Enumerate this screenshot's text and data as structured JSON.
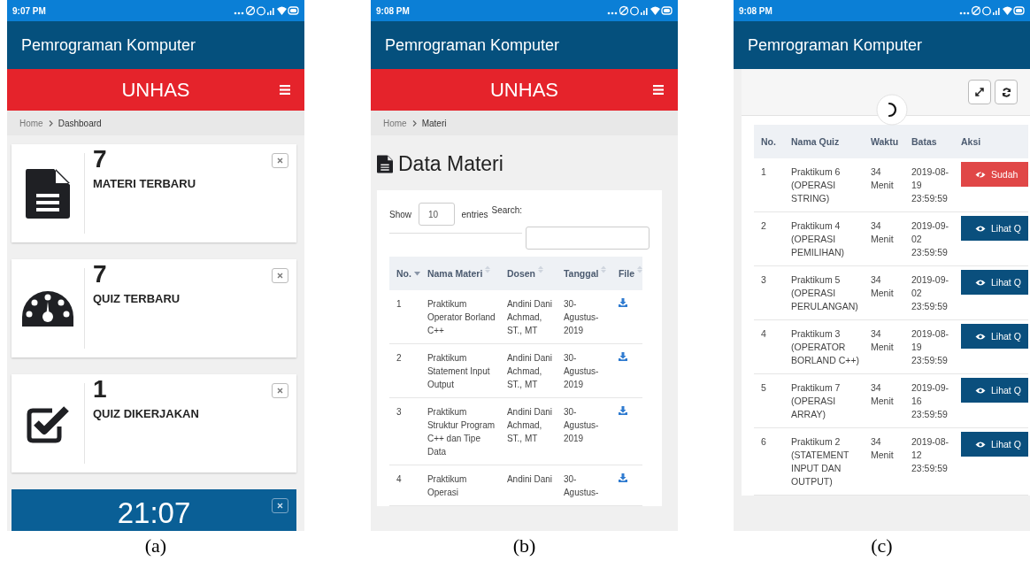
{
  "panels": [
    {
      "kind": "dashboard",
      "caption": "(a)",
      "status_time": "9:07 PM",
      "app_title": "Pemrograman Komputer",
      "brand": "UNHAS",
      "breadcrumb": [
        "Home",
        "Dashboard"
      ],
      "cards": [
        {
          "kind": "document",
          "count": "7",
          "label": "MATERI TERBARU"
        },
        {
          "kind": "gauge",
          "count": "7",
          "label": "QUIZ TERBARU"
        },
        {
          "kind": "checkbox",
          "count": "1",
          "label": "QUIZ DIKERJAKAN"
        }
      ],
      "clock": "21:07"
    },
    {
      "kind": "materials",
      "caption": "(b)",
      "status_time": "9:08 PM",
      "app_title": "Pemrograman Komputer",
      "brand": "UNHAS",
      "breadcrumb": [
        "Home",
        "Materi"
      ],
      "page_title": "Data Materi",
      "show_label": "Show",
      "show_value": "10",
      "entries_label": "entries",
      "search_label": "Search:",
      "columns": [
        {
          "label": "No.",
          "sorted": true
        },
        {
          "label": "Nama Materi",
          "sorted": false
        },
        {
          "label": "Dosen",
          "sorted": false
        },
        {
          "label": "Tanggal",
          "sorted": false
        },
        {
          "label": "File",
          "sorted": false
        }
      ],
      "rows": [
        {
          "no": "1",
          "name": "Praktikum Operator Borland C++",
          "lecturer": "Andini Dani Achmad, ST., MT",
          "date": "30-Agustus-2019"
        },
        {
          "no": "2",
          "name": "Praktikum Statement Input Output",
          "lecturer": "Andini Dani Achmad, ST., MT",
          "date": "30-Agustus-2019"
        },
        {
          "no": "3",
          "name": "Praktikum Struktur Program C++ dan Tipe Data",
          "lecturer": "Andini Dani Achmad, ST., MT",
          "date": "30-Agustus-2019"
        },
        {
          "no": "4",
          "name": "Praktikum Operasi",
          "lecturer": "Andini Dani",
          "date": "30-Agustus-"
        }
      ]
    },
    {
      "kind": "quizzes",
      "caption": "(c)",
      "status_time": "9:08 PM",
      "app_title": "Pemrograman Komputer",
      "columns": [
        "No.",
        "Nama Quiz",
        "Waktu",
        "Batas",
        "Aksi"
      ],
      "rows": [
        {
          "no": "1",
          "name": "Praktikum 6 (OPERASI STRING)",
          "duration": "34 Menit",
          "deadline": "2019-08-19 23:59:59",
          "action": {
            "kind": "done",
            "label": "Sudah"
          }
        },
        {
          "no": "2",
          "name": "Praktikum 4 (OPERASI PEMILIHAN)",
          "duration": "34 Menit",
          "deadline": "2019-09-02 23:59:59",
          "action": {
            "kind": "view",
            "label": "Lihat Q"
          }
        },
        {
          "no": "3",
          "name": "Praktikum 5 (OPERASI PERULANGAN)",
          "duration": "34 Menit",
          "deadline": "2019-09-02 23:59:59",
          "action": {
            "kind": "view",
            "label": "Lihat Q"
          }
        },
        {
          "no": "4",
          "name": "Praktikum 3 (OPERATOR BORLAND C++)",
          "duration": "34 Menit",
          "deadline": "2019-08-19 23:59:59",
          "action": {
            "kind": "view",
            "label": "Lihat Q"
          }
        },
        {
          "no": "5",
          "name": "Praktikum 7 (OPERASI ARRAY)",
          "duration": "34 Menit",
          "deadline": "2019-09-16 23:59:59",
          "action": {
            "kind": "view",
            "label": "Lihat Q"
          }
        },
        {
          "no": "6",
          "name": "Praktikum 2 (STATEMENT INPUT DAN OUTPUT)",
          "duration": "34 Menit",
          "deadline": "2019-08-12 23:59:59",
          "action": {
            "kind": "view",
            "label": "Lihat Q"
          }
        }
      ]
    }
  ]
}
